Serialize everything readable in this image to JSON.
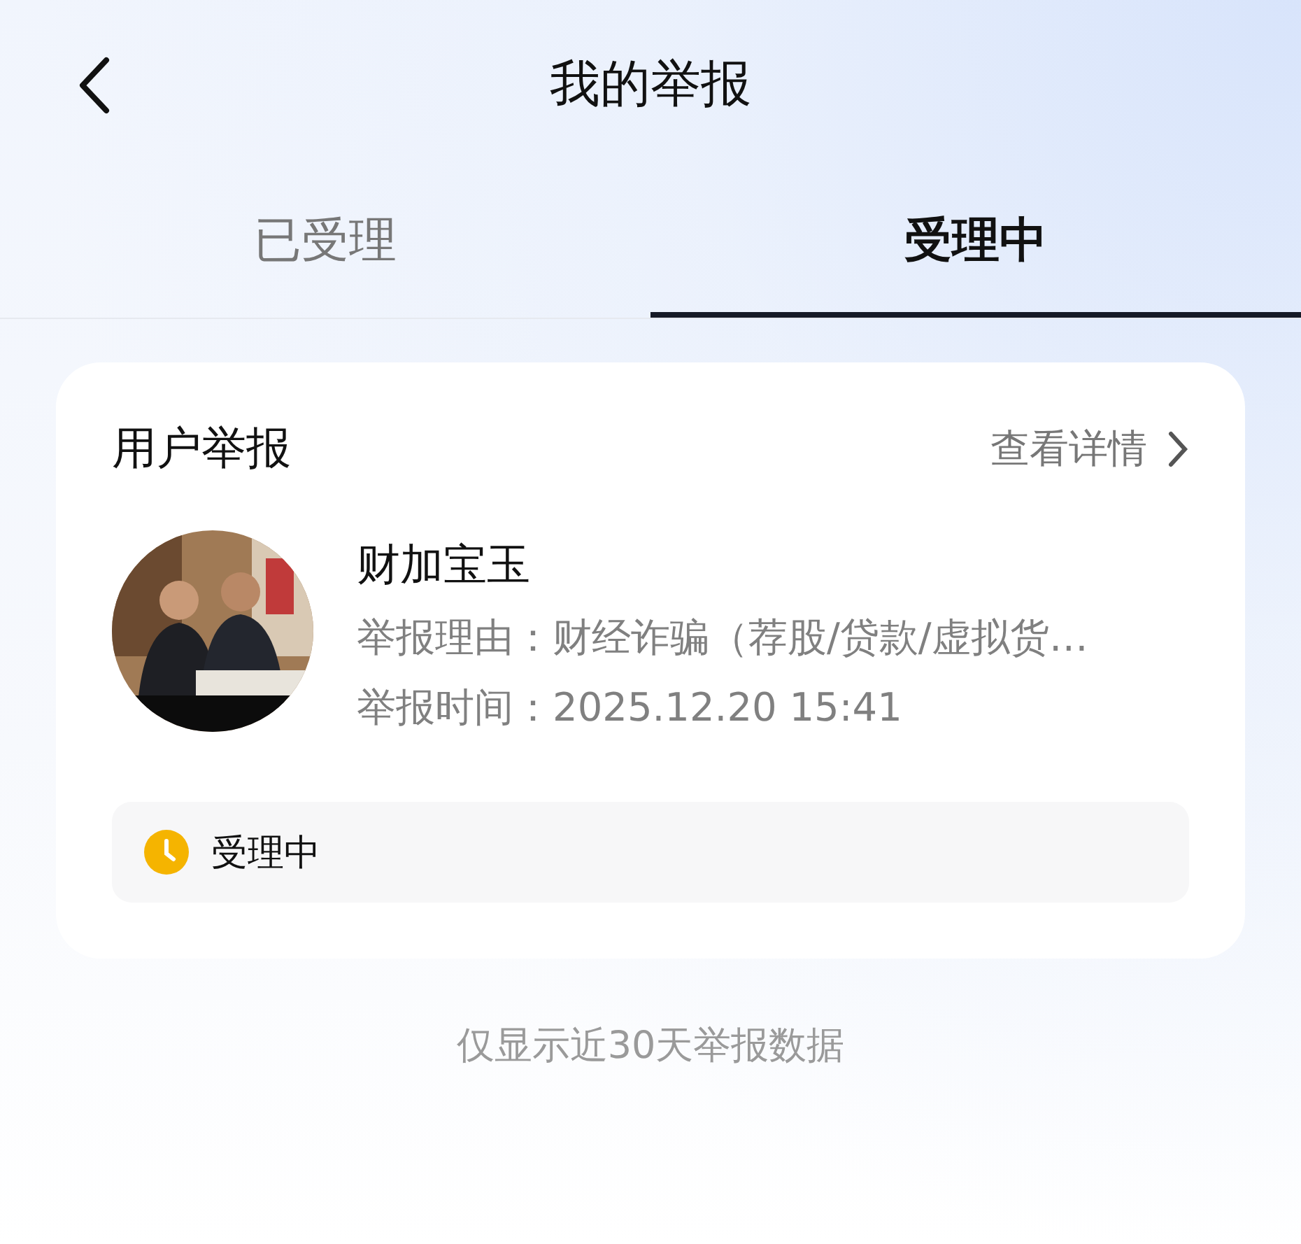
{
  "header": {
    "title": "我的举报"
  },
  "tabs": [
    {
      "label": "已受理",
      "selected": false
    },
    {
      "label": "受理中",
      "selected": true
    }
  ],
  "report": {
    "title": "用户举报",
    "details_link": "查看详情",
    "name": "财加宝玉",
    "reason": "举报理由：财经诈骗（荐股/贷款/虚拟货…",
    "time": "举报时间：2025.12.20 15:41",
    "status": "受理中"
  },
  "footer_note": "仅显示近30天举报数据"
}
